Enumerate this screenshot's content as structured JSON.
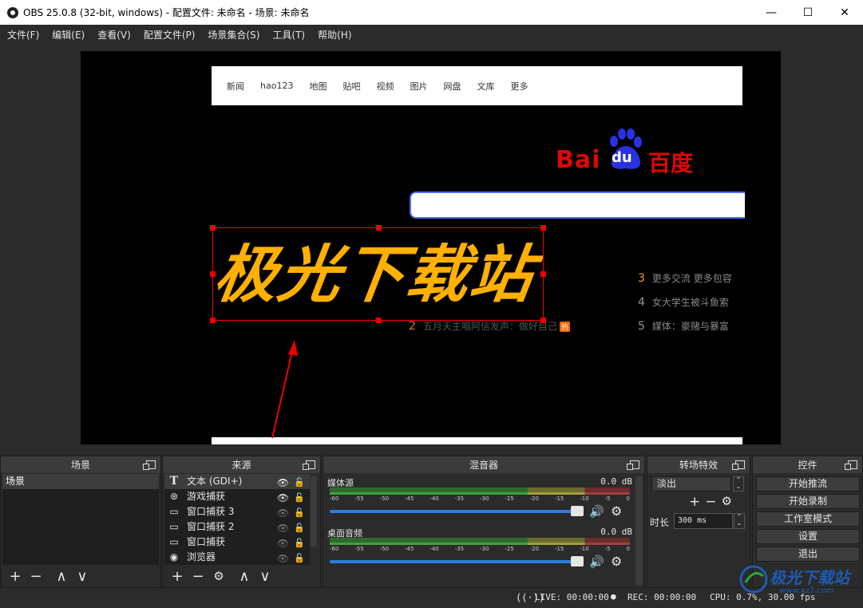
{
  "window": {
    "title": "OBS 25.0.8 (32-bit, windows) - 配置文件: 未命名 - 场景: 未命名",
    "minimize": "—",
    "maximize": "☐",
    "close": "✕"
  },
  "menu": [
    "文件(F)",
    "编辑(E)",
    "查看(V)",
    "配置文件(P)",
    "场景集合(S)",
    "工具(T)",
    "帮助(H)"
  ],
  "preview": {
    "nav": [
      "新闻",
      "hao123",
      "地图",
      "贴吧",
      "视频",
      "图片",
      "网盘",
      "文库",
      "更多"
    ],
    "logo": {
      "latin": "Bai",
      "du": "du",
      "cn": "百度"
    },
    "hot": [
      {
        "num": "3",
        "text": "更多交流 更多包容"
      },
      {
        "num": "4",
        "text": "女大学生被斗鱼索"
      },
      {
        "num": "5",
        "text": "媒体：豪赌与暴富"
      },
      {
        "num": "2",
        "text": "五月天主唱阿信发声：做好自己",
        "badge": "热"
      }
    ],
    "overlay_text": "极光下载站"
  },
  "docks": {
    "scenes": {
      "title": "场景",
      "items": [
        "场景"
      ]
    },
    "sources": {
      "title": "来源",
      "items": [
        {
          "icon": "T",
          "label": "文本 (GDI+)"
        },
        {
          "icon": "⊛",
          "label": "游戏捕获"
        },
        {
          "icon": "▭",
          "label": "窗口捕获 3"
        },
        {
          "icon": "▭",
          "label": "窗口捕获 2"
        },
        {
          "icon": "▭",
          "label": "窗口捕获"
        },
        {
          "icon": "◉",
          "label": "浏览器"
        }
      ]
    },
    "mixer": {
      "title": "混音器",
      "channels": [
        {
          "name": "媒体源",
          "db": "0.0 dB",
          "level": 0.92
        },
        {
          "name": "桌面音频",
          "db": "0.0 dB",
          "level": 0.92
        }
      ],
      "scale": [
        "-60",
        "-55",
        "-50",
        "-45",
        "-40",
        "-35",
        "-30",
        "-25",
        "-20",
        "-15",
        "-10",
        "-5",
        "0"
      ]
    },
    "transitions": {
      "title": "转场特效",
      "selected": "淡出",
      "duration_label": "时长",
      "duration_value": "300 ms"
    },
    "controls": {
      "title": "控件",
      "buttons": [
        "开始推流",
        "开始录制",
        "工作室模式",
        "设置",
        "退出"
      ]
    }
  },
  "status": {
    "live": "LIVE: 00:00:00",
    "rec": "REC: 00:00:00",
    "cpu": "CPU: 0.7%, 30.00 fps"
  },
  "watermark": {
    "title": "极光下载站",
    "url": "www.xz7.com"
  },
  "colors": {
    "accent": "#2b7dde",
    "selection": "#e00000",
    "overlay_text": "#ffb000",
    "baidu_red": "#e10601",
    "baidu_blue": "#2932e1"
  }
}
